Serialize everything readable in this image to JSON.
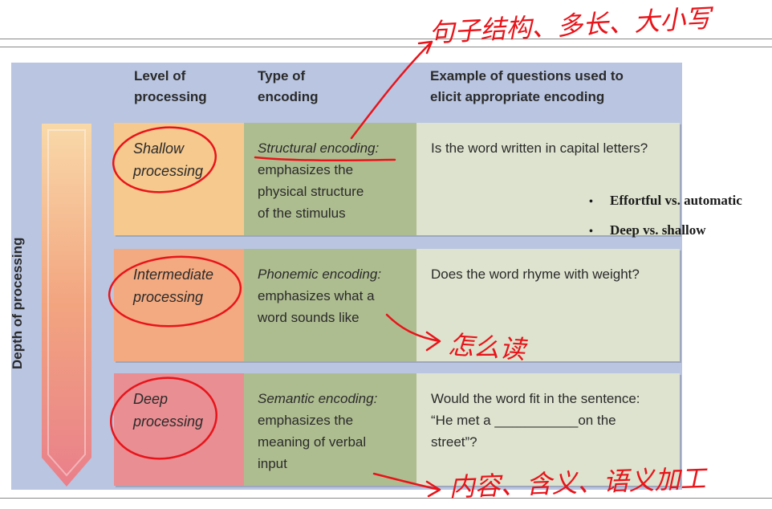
{
  "headers": {
    "level": "Level of\nprocessing",
    "type": "Type of\nencoding",
    "example": "Example of questions used to\nelicit appropriate encoding"
  },
  "depth_label": "Depth of processing",
  "rows": [
    {
      "level": "Shallow\nprocessing",
      "encoding_title": "Structural encoding:",
      "encoding_desc": "emphasizes the\nphysical structure\nof the stimulus",
      "example": "Is the word written in capital letters?",
      "level_color": "#f6c98e"
    },
    {
      "level": "Intermediate\nprocessing",
      "encoding_title": "Phonemic encoding:",
      "encoding_desc": "emphasizes what a\nword sounds like",
      "example": "Does the word rhyme with weight?",
      "level_color": "#f3aa80"
    },
    {
      "level": "Deep\nprocessing",
      "encoding_title": "Semantic encoding:",
      "encoding_desc": "emphasizes the\nmeaning of verbal\ninput",
      "example": "Would the word fit in the sentence:\n“He met a ___________on the\nstreet”?",
      "level_color": "#e98e93"
    }
  ],
  "bullets": [
    "Effortful vs. automatic",
    "Deep vs. shallow"
  ],
  "handwritten_notes": {
    "top": "句子结构、多长、大小写",
    "middle": "怎么读",
    "bottom": "内容、含义、语义加工"
  },
  "colors": {
    "panel": "#b9c5e1",
    "encoding": "#aebd90",
    "example": "#dde3ce",
    "ink": "#e8141a"
  }
}
